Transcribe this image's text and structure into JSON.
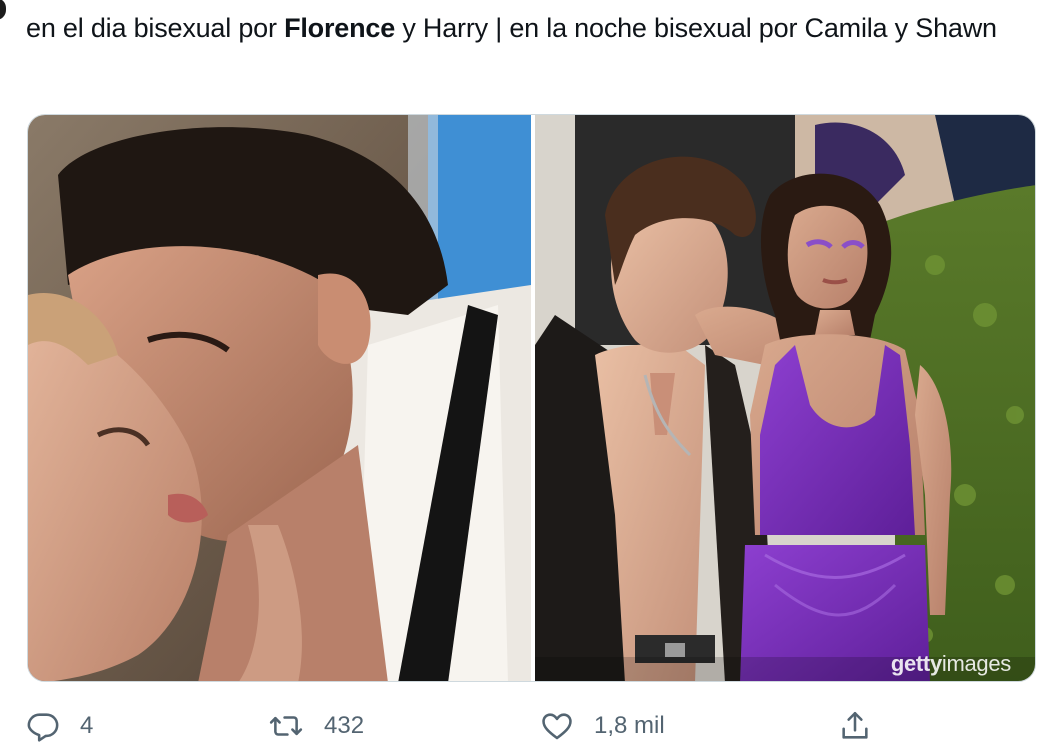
{
  "tweet": {
    "text_part1": "en el dia bisexual por ",
    "text_bold": "Florence",
    "text_part2": " y Harry | en la noche bisexual por Camila y Shawn"
  },
  "media": {
    "watermark_bold": "getty",
    "watermark_rest": "images"
  },
  "actions": {
    "replies": "4",
    "retweets": "432",
    "likes": "1,8 mil"
  },
  "colors": {
    "icon": "#536471",
    "text": "#0f1419",
    "border": "#cfd9de",
    "dress": "#7b2fb8"
  }
}
